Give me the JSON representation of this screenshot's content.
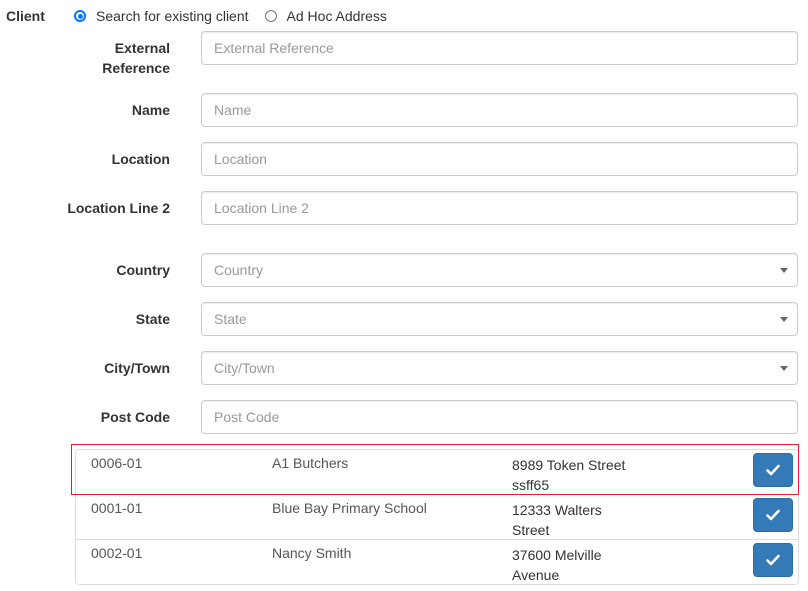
{
  "client": {
    "label": "Client",
    "options": [
      {
        "label": "Search for existing client",
        "checked": true
      },
      {
        "label": "Ad Hoc Address",
        "checked": false
      }
    ]
  },
  "fields": {
    "external_reference": {
      "label": "External Reference",
      "placeholder": "External Reference",
      "value": ""
    },
    "name": {
      "label": "Name",
      "placeholder": "Name",
      "value": ""
    },
    "location": {
      "label": "Location",
      "placeholder": "Location",
      "value": ""
    },
    "location_line_2": {
      "label": "Location Line 2",
      "placeholder": "Location Line 2",
      "value": ""
    },
    "country": {
      "label": "Country",
      "placeholder": "Country",
      "value": ""
    },
    "state": {
      "label": "State",
      "placeholder": "State",
      "value": ""
    },
    "city_town": {
      "label": "City/Town",
      "placeholder": "City/Town",
      "value": ""
    },
    "post_code": {
      "label": "Post Code",
      "placeholder": "Post Code",
      "value": ""
    }
  },
  "results": [
    {
      "ref": "0006-01",
      "name": "A1 Butchers",
      "address": "8989 Token Street ssff65",
      "highlighted": true
    },
    {
      "ref": "0001-01",
      "name": "Blue Bay Primary School",
      "address": "12333 Walters Street",
      "highlighted": false
    },
    {
      "ref": "0002-01",
      "name": "Nancy Smith",
      "address": "37600 Melville Avenue",
      "highlighted": false
    }
  ],
  "colors": {
    "accent": "#0075ff",
    "button": "#337ab7",
    "highlight_border": "#d9232e"
  }
}
